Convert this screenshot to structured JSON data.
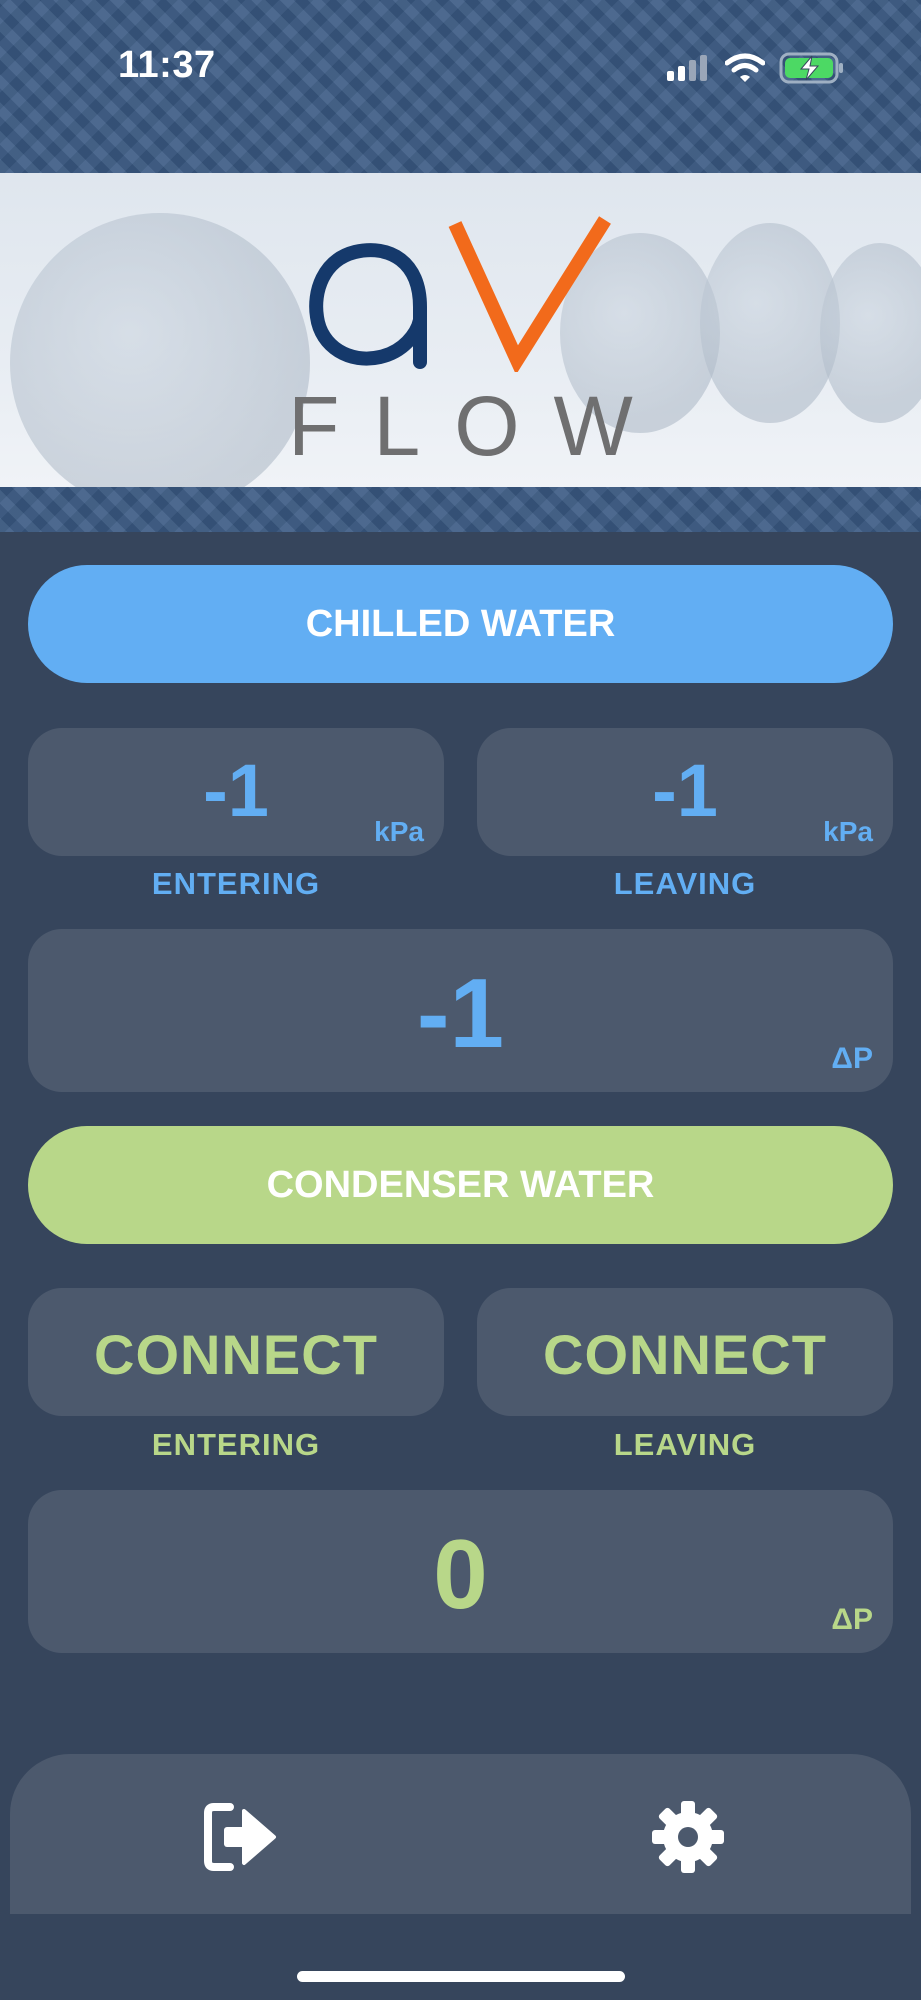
{
  "status_bar": {
    "time": "11:37",
    "signal_icon": "cellular-signal-icon",
    "wifi_icon": "wifi-icon",
    "battery_icon": "battery-charging-icon"
  },
  "logo": {
    "letters": "aV",
    "wordmark": "FLOW",
    "primary_color": "#15396b",
    "accent_color": "#f26a1b"
  },
  "chilled_water": {
    "button_label": "CHILLED WATER",
    "entering": {
      "value": "-1",
      "unit": "kPa",
      "label": "ENTERING"
    },
    "leaving": {
      "value": "-1",
      "unit": "kPa",
      "label": "LEAVING"
    },
    "delta": {
      "value": "-1",
      "unit": "ΔP"
    },
    "color": "#62aef3"
  },
  "condenser_water": {
    "button_label": "CONDENSER WATER",
    "entering": {
      "value": "CONNECT",
      "label": "ENTERING"
    },
    "leaving": {
      "value": "CONNECT",
      "label": "LEAVING"
    },
    "delta": {
      "value": "0",
      "unit": "ΔP"
    },
    "color": "#b8d789"
  },
  "bottom_nav": {
    "logout_icon": "logout-icon",
    "settings_icon": "gear-icon"
  }
}
